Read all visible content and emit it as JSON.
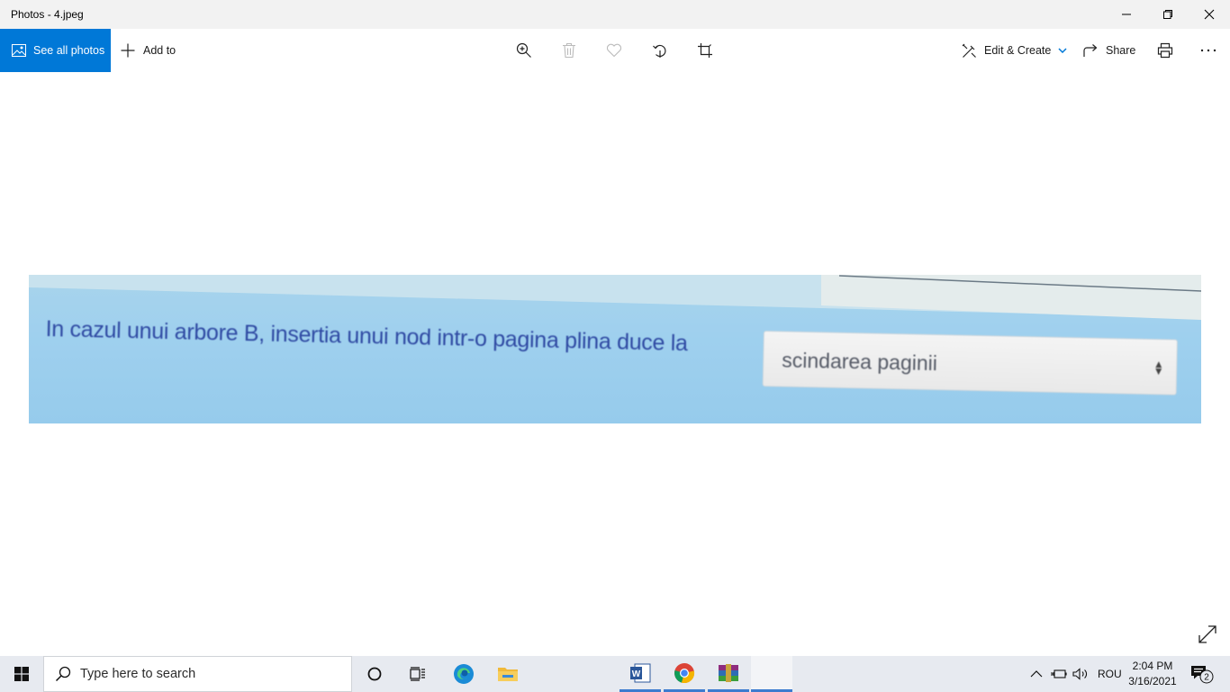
{
  "window": {
    "title": "Photos - 4.jpeg"
  },
  "toolbar": {
    "see_all": "See all photos",
    "add_to": "Add to",
    "edit_create": "Edit & Create",
    "share": "Share"
  },
  "photo": {
    "question": "In cazul unui arbore B, insertia unui nod intr-o pagina plina duce la",
    "selected_answer": "scindarea paginii"
  },
  "taskbar": {
    "search_placeholder": "Type here to search",
    "language": "ROU",
    "time": "2:04 PM",
    "date": "3/16/2021",
    "notification_count": "2"
  },
  "colors": {
    "accent": "#0078d7",
    "photo_bg": "#9fd0ee",
    "question_text": "#2f4aa3"
  }
}
